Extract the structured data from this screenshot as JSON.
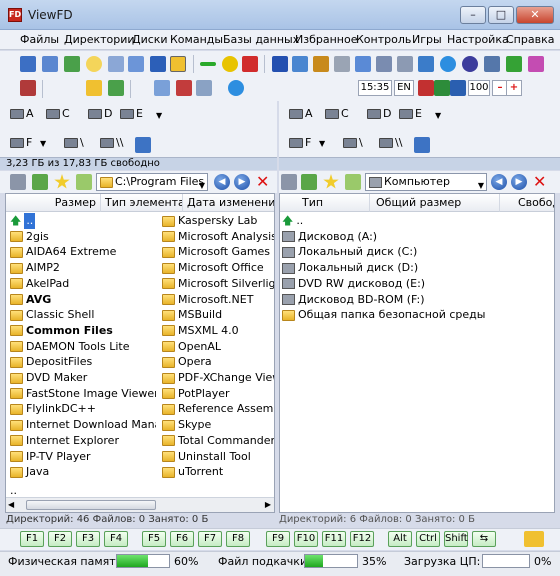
{
  "window": {
    "title": "ViewFD",
    "icon_text": "FD"
  },
  "window_buttons": {
    "minimize": "–",
    "maximize": "□",
    "close": "✕"
  },
  "menu": [
    "Файлы",
    "Директории",
    "Диски",
    "Команды",
    "Базы данных",
    "Избранное",
    "Контроль",
    "Игры",
    "Настройка",
    "Справка"
  ],
  "toolbar": {
    "time": "15:35",
    "lang": "EN",
    "volume": "100",
    "minus": "–",
    "plus": "+"
  },
  "drives": {
    "left": [
      "A",
      "C",
      "D",
      "E",
      "F",
      "\\",
      "\\\\"
    ],
    "right": [
      "A",
      "C",
      "D",
      "E",
      "F",
      "\\",
      "\\\\"
    ]
  },
  "disk_info": "3,23 ГБ из 17,83 ГБ свободно",
  "left_panel": {
    "path": "C:\\Program Files",
    "headers": [
      "Размер",
      "Тип элемента",
      "Дата изменения"
    ],
    "col1": [
      {
        "name": "..",
        "bold": false,
        "up": true
      },
      {
        "name": "2gis",
        "bold": false
      },
      {
        "name": "AIDA64 Extreme",
        "bold": false
      },
      {
        "name": "AIMP2",
        "bold": false
      },
      {
        "name": "AkelPad",
        "bold": false
      },
      {
        "name": "AVG",
        "bold": true
      },
      {
        "name": "Classic Shell",
        "bold": false
      },
      {
        "name": "Common Files",
        "bold": true
      },
      {
        "name": "DAEMON Tools Lite",
        "bold": false
      },
      {
        "name": "DepositFiles",
        "bold": false
      },
      {
        "name": "DVD Maker",
        "bold": false
      },
      {
        "name": "FastStone Image Viewer",
        "bold": false
      },
      {
        "name": "FlylinkDC++",
        "bold": false
      },
      {
        "name": "Internet Download Manager",
        "bold": false
      },
      {
        "name": "Internet Explorer",
        "bold": false
      },
      {
        "name": "IP-TV Player",
        "bold": false
      },
      {
        "name": "Java",
        "bold": false
      }
    ],
    "col2": [
      "Kaspersky Lab",
      "Microsoft Analysis Services",
      "Microsoft Games",
      "Microsoft Office",
      "Microsoft Silverlight",
      "Microsoft.NET",
      "MSBuild",
      "MSXML 4.0",
      "OpenAL",
      "Opera",
      "PDF-XChange Viewer",
      "PotPlayer",
      "Reference Assemblies",
      "Skype",
      "Total Commander",
      "Uninstall Tool",
      "uTorrent"
    ],
    "bottom_item": "..",
    "status": "Директорий: 46   Файлов: 0   Занято: 0 Б"
  },
  "right_panel": {
    "path": "Компьютер",
    "headers": [
      "Тип",
      "Общий размер",
      "Свобод"
    ],
    "items": [
      "..",
      "Дисковод (A:)",
      "Локальный диск (C:)",
      "Локальный диск (D:)",
      "DVD RW дисковод (E:)",
      "Дисковод BD-ROM (F:)",
      "Общая папка безопасной среды"
    ],
    "status": "Директорий: 6   Файлов: 0   Занято: 0 Б"
  },
  "fkeys": [
    "F1",
    "F2",
    "F3",
    "F4",
    "F5",
    "F6",
    "F7",
    "F8",
    "F9",
    "F10",
    "F11",
    "F12",
    "Alt",
    "Ctrl",
    "Shift",
    "⇆"
  ],
  "stats": {
    "memory_label": "Физическая память:",
    "memory_value": "60%",
    "memory_fraction": 0.6,
    "swap_label": "Файл подкачки:",
    "swap_value": "35%",
    "swap_fraction": 0.35,
    "cpu_label": "Загрузка ЦП:",
    "cpu_value": "0%",
    "cpu_fraction": 0.0
  }
}
